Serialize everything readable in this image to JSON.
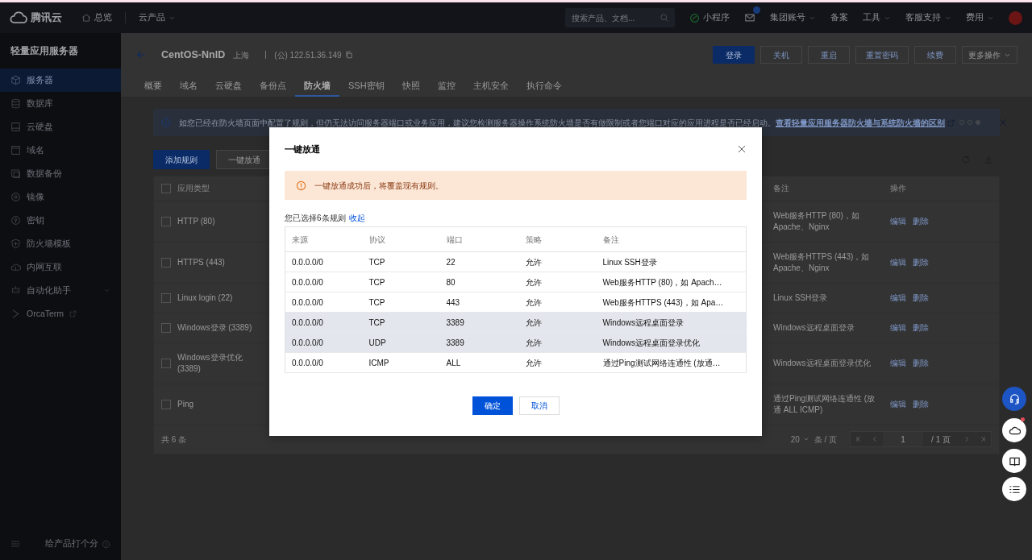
{
  "topbar": {
    "brand": "腾讯云",
    "nav": [
      {
        "label": "总览",
        "kind": "home"
      },
      {
        "label": "云产品",
        "kind": "dropdown"
      }
    ],
    "search": {
      "placeholder": "搜索产品、文档..."
    },
    "links": [
      {
        "label": "小程序",
        "kind": "miniapp"
      },
      {
        "kind": "mail"
      },
      {
        "label": "集团账号",
        "kind": "dropdown"
      },
      {
        "label": "备案",
        "kind": "link"
      },
      {
        "label": "工具",
        "kind": "dropdown"
      },
      {
        "label": "客服支持",
        "kind": "dropdown"
      },
      {
        "label": "费用",
        "kind": "dropdown"
      },
      {
        "kind": "avatar"
      }
    ]
  },
  "sidebar": {
    "title": "轻量应用服务器",
    "items": [
      {
        "label": "服务器",
        "selected": true,
        "kind": "plain"
      },
      {
        "label": "数据库",
        "selected": false,
        "kind": "plain"
      },
      {
        "label": "云硬盘",
        "selected": false,
        "kind": "plain"
      },
      {
        "label": "域名",
        "selected": false,
        "kind": "plain"
      },
      {
        "label": "数据备份",
        "selected": false,
        "kind": "plain"
      },
      {
        "label": "镜像",
        "selected": false,
        "kind": "plain"
      },
      {
        "label": "密钥",
        "selected": false,
        "kind": "plain"
      },
      {
        "label": "防火墙模板",
        "selected": false,
        "kind": "plain"
      },
      {
        "label": "内网互联",
        "selected": false,
        "kind": "plain"
      },
      {
        "label": "自动化助手",
        "selected": false,
        "kind": "expandable"
      },
      {
        "label": "OrcaTerm",
        "selected": false,
        "kind": "external"
      }
    ],
    "footer": "给产品打个分"
  },
  "header": {
    "title": "CentOS-NnlD",
    "region": "上海",
    "ip": "(公) 122.51.36.149",
    "buttons": [
      {
        "label": "登录",
        "kind": "primary"
      },
      {
        "label": "关机",
        "kind": "default"
      },
      {
        "label": "重启",
        "kind": "default"
      },
      {
        "label": "重置密码",
        "kind": "default"
      },
      {
        "label": "续费",
        "kind": "default"
      },
      {
        "label": "更多操作",
        "kind": "dropdown"
      }
    ]
  },
  "tabs": [
    {
      "label": "概要",
      "selected": false
    },
    {
      "label": "域名",
      "selected": false
    },
    {
      "label": "云硬盘",
      "selected": false
    },
    {
      "label": "备份点",
      "selected": false
    },
    {
      "label": "防火墙",
      "selected": true
    },
    {
      "label": "SSH密钥",
      "selected": false
    },
    {
      "label": "快照",
      "selected": false
    },
    {
      "label": "监控",
      "selected": false
    },
    {
      "label": "主机安全",
      "selected": false
    },
    {
      "label": "执行命令",
      "selected": false
    }
  ],
  "notice": {
    "text": "如您已经在防火墙页面中配置了规则，但仍无法访问服务器端口或业务应用，建议您检测服务器操作系统防火墙是否有做限制或者您端口对应的应用进程是否已经启动。",
    "link": "查看轻量应用服务器防火墙与系统防火墙的区别",
    "pages": [
      {
        "selected": false
      },
      {
        "selected": false
      },
      {
        "selected": true
      }
    ]
  },
  "toolbar": {
    "buttons": [
      {
        "label": "添加规则",
        "kind": "primary"
      },
      {
        "label": "一键放通",
        "kind": "default"
      }
    ]
  },
  "rules_table": {
    "columns": [
      "应用类型",
      "备注",
      "操作"
    ],
    "all_checked": false,
    "rows": [
      {
        "type": "HTTP (80)",
        "checked": false,
        "note": "Web服务HTTP (80)，如 Apache、Nginx",
        "actions": [
          "编辑",
          "删除"
        ]
      },
      {
        "type": "HTTPS (443)",
        "checked": false,
        "note": "Web服务HTTPS (443)，如 Apache、Nginx",
        "actions": [
          "编辑",
          "删除"
        ]
      },
      {
        "type": "Linux login (22)",
        "checked": false,
        "note": "Linux SSH登录",
        "actions": [
          "编辑",
          "删除"
        ]
      },
      {
        "type": "Windows登录 (3389)",
        "checked": false,
        "note": "Windows远程桌面登录",
        "actions": [
          "编辑",
          "删除"
        ]
      },
      {
        "type": "Windows登录优化 (3389)",
        "checked": false,
        "note": "Windows远程桌面登录优化",
        "actions": [
          "编辑",
          "删除"
        ]
      },
      {
        "type": "Ping",
        "checked": false,
        "note": "通过Ping测试网络连通性 (放通 ALL ICMP)",
        "actions": [
          "编辑",
          "删除"
        ]
      }
    ],
    "total": "共 6 条",
    "page_size": "20",
    "page_size_unit": "条 / 页",
    "page": "1",
    "page_total": "/ 1 页"
  },
  "dialog": {
    "title": "一键放通",
    "alert": "一键放通成功后，将覆盖现有规则。",
    "summary": "您已选择6条规则",
    "toggle": "收起",
    "columns": [
      "来源",
      "协议",
      "端口",
      "策略",
      "备注"
    ],
    "rows": [
      {
        "cells": [
          "0.0.0.0/0",
          "TCP",
          "22",
          "允许",
          "Linux SSH登录"
        ],
        "highlighted": false
      },
      {
        "cells": [
          "0.0.0.0/0",
          "TCP",
          "80",
          "允许",
          "Web服务HTTP (80)，如 Apach…"
        ],
        "highlighted": false
      },
      {
        "cells": [
          "0.0.0.0/0",
          "TCP",
          "443",
          "允许",
          "Web服务HTTPS (443)，如 Apa…"
        ],
        "highlighted": false
      },
      {
        "cells": [
          "0.0.0.0/0",
          "TCP",
          "3389",
          "允许",
          "Windows远程桌面登录"
        ],
        "highlighted": true
      },
      {
        "cells": [
          "0.0.0.0/0",
          "UDP",
          "3389",
          "允许",
          "Windows远程桌面登录优化"
        ],
        "highlighted": true
      },
      {
        "cells": [
          "0.0.0.0/0",
          "ICMP",
          "ALL",
          "允许",
          "通过Ping测试网络连通性 (放通…"
        ],
        "highlighted": false
      }
    ],
    "buttons": [
      {
        "label": "确定",
        "kind": "primary"
      },
      {
        "label": "取消",
        "kind": "default"
      }
    ]
  }
}
